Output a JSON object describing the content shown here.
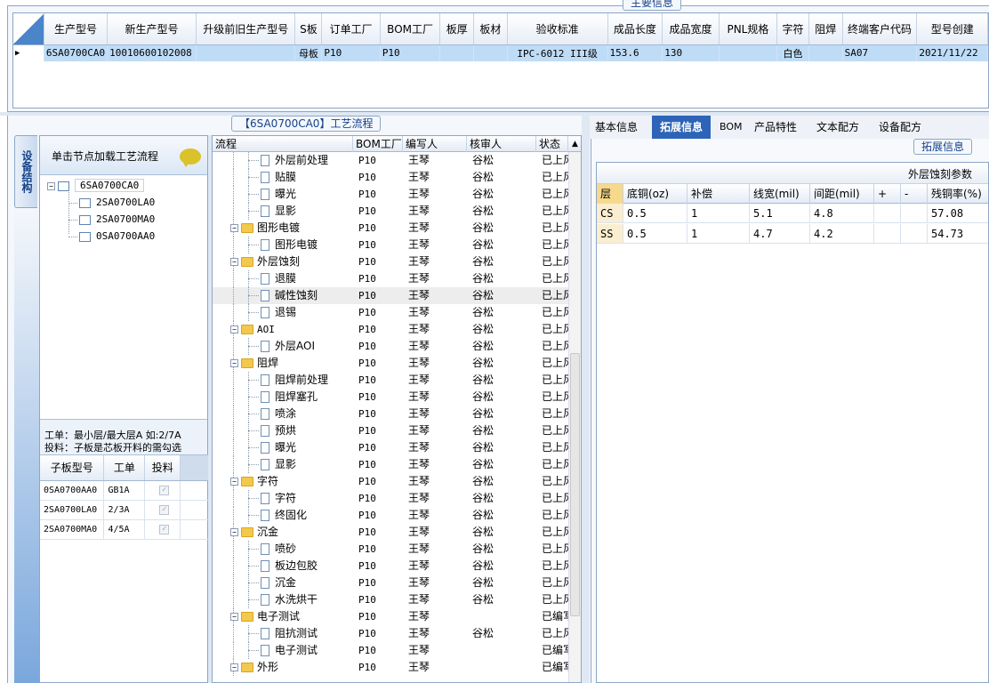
{
  "top": {
    "group_title": "主要信息",
    "columns": [
      "生产型号",
      "新生产型号",
      "升级前旧生产型号",
      "S板",
      "订单工厂",
      "BOM工厂",
      "板厚",
      "板材",
      "验收标准",
      "成品长度",
      "成品宽度",
      "PNL规格",
      "字符",
      "阻焊",
      "终端客户代码",
      "型号创建"
    ],
    "row": [
      "6SA0700CA0",
      "10010600102008",
      "",
      "母板",
      "P10",
      "P10",
      "",
      "",
      "IPC-6012 III级",
      "153.6",
      "130",
      "",
      "白色",
      "",
      "SA07",
      "2021/11/22"
    ]
  },
  "left": {
    "vertical_tab": "设备结构",
    "header_text": "单击节点加载工艺流程",
    "tree": {
      "root": "6SA0700CA0",
      "children": [
        "2SA0700LA0",
        "2SA0700MA0",
        "0SA0700AA0"
      ]
    },
    "note_line1": "工单：最小层/最大层A 如:2/7A",
    "note_line2": "投料：子板是芯板开料的需勾选",
    "subgrid": {
      "columns": [
        "子板型号",
        "工单",
        "投料"
      ],
      "rows": [
        [
          "0SA0700AA0",
          "GB1A",
          "✓"
        ],
        [
          "2SA0700LA0",
          "2/3A",
          "✓"
        ],
        [
          "2SA0700MA0",
          "4/5A",
          "✓"
        ]
      ]
    }
  },
  "middle": {
    "group_title": "【6SA0700CA0】工艺流程",
    "columns": [
      "流程",
      "BOM工厂",
      "编写人",
      "核审人",
      "状态"
    ],
    "rows": [
      {
        "name": "外层前处理",
        "folder": false,
        "bom": "P10",
        "writer": "王琴",
        "reviewer": "谷松",
        "status": "已上风"
      },
      {
        "name": "贴膜",
        "folder": false,
        "bom": "P10",
        "writer": "王琴",
        "reviewer": "谷松",
        "status": "已上风"
      },
      {
        "name": "曝光",
        "folder": false,
        "bom": "P10",
        "writer": "王琴",
        "reviewer": "谷松",
        "status": "已上风"
      },
      {
        "name": "显影",
        "folder": false,
        "bom": "P10",
        "writer": "王琴",
        "reviewer": "谷松",
        "status": "已上风"
      },
      {
        "name": "图形电镀",
        "folder": true,
        "bom": "P10",
        "writer": "王琴",
        "reviewer": "谷松",
        "status": "已上风"
      },
      {
        "name": "图形电镀",
        "folder": false,
        "bom": "P10",
        "writer": "王琴",
        "reviewer": "谷松",
        "status": "已上风"
      },
      {
        "name": "外层蚀刻",
        "folder": true,
        "bom": "P10",
        "writer": "王琴",
        "reviewer": "谷松",
        "status": "已上风"
      },
      {
        "name": "退膜",
        "folder": false,
        "bom": "P10",
        "writer": "王琴",
        "reviewer": "谷松",
        "status": "已上风"
      },
      {
        "name": "碱性蚀刻",
        "folder": false,
        "bom": "P10",
        "writer": "王琴",
        "reviewer": "谷松",
        "status": "已上风",
        "selected": true
      },
      {
        "name": "退锡",
        "folder": false,
        "bom": "P10",
        "writer": "王琴",
        "reviewer": "谷松",
        "status": "已上风"
      },
      {
        "name": "AOI",
        "folder": true,
        "bom": "P10",
        "writer": "王琴",
        "reviewer": "谷松",
        "status": "已上风"
      },
      {
        "name": "外层AOI",
        "folder": false,
        "bom": "P10",
        "writer": "王琴",
        "reviewer": "谷松",
        "status": "已上风"
      },
      {
        "name": "阻焊",
        "folder": true,
        "bom": "P10",
        "writer": "王琴",
        "reviewer": "谷松",
        "status": "已上风"
      },
      {
        "name": "阻焊前处理",
        "folder": false,
        "bom": "P10",
        "writer": "王琴",
        "reviewer": "谷松",
        "status": "已上风"
      },
      {
        "name": "阻焊塞孔",
        "folder": false,
        "bom": "P10",
        "writer": "王琴",
        "reviewer": "谷松",
        "status": "已上风"
      },
      {
        "name": "喷涂",
        "folder": false,
        "bom": "P10",
        "writer": "王琴",
        "reviewer": "谷松",
        "status": "已上风"
      },
      {
        "name": "预烘",
        "folder": false,
        "bom": "P10",
        "writer": "王琴",
        "reviewer": "谷松",
        "status": "已上风"
      },
      {
        "name": "曝光",
        "folder": false,
        "bom": "P10",
        "writer": "王琴",
        "reviewer": "谷松",
        "status": "已上风"
      },
      {
        "name": "显影",
        "folder": false,
        "bom": "P10",
        "writer": "王琴",
        "reviewer": "谷松",
        "status": "已上风"
      },
      {
        "name": "字符",
        "folder": true,
        "bom": "P10",
        "writer": "王琴",
        "reviewer": "谷松",
        "status": "已上风"
      },
      {
        "name": "字符",
        "folder": false,
        "bom": "P10",
        "writer": "王琴",
        "reviewer": "谷松",
        "status": "已上风"
      },
      {
        "name": "终固化",
        "folder": false,
        "bom": "P10",
        "writer": "王琴",
        "reviewer": "谷松",
        "status": "已上风"
      },
      {
        "name": "沉金",
        "folder": true,
        "bom": "P10",
        "writer": "王琴",
        "reviewer": "谷松",
        "status": "已上风"
      },
      {
        "name": "喷砂",
        "folder": false,
        "bom": "P10",
        "writer": "王琴",
        "reviewer": "谷松",
        "status": "已上风"
      },
      {
        "name": "板边包胶",
        "folder": false,
        "bom": "P10",
        "writer": "王琴",
        "reviewer": "谷松",
        "status": "已上风"
      },
      {
        "name": "沉金",
        "folder": false,
        "bom": "P10",
        "writer": "王琴",
        "reviewer": "谷松",
        "status": "已上风"
      },
      {
        "name": "水洗烘干",
        "folder": false,
        "bom": "P10",
        "writer": "王琴",
        "reviewer": "谷松",
        "status": "已上风"
      },
      {
        "name": "电子测试",
        "folder": true,
        "bom": "P10",
        "writer": "王琴",
        "reviewer": "",
        "status": "已编写"
      },
      {
        "name": "阻抗测试",
        "folder": false,
        "bom": "P10",
        "writer": "王琴",
        "reviewer": "谷松",
        "status": "已上风"
      },
      {
        "name": "电子测试",
        "folder": false,
        "bom": "P10",
        "writer": "王琴",
        "reviewer": "",
        "status": "已编写"
      },
      {
        "name": "外形",
        "folder": true,
        "bom": "P10",
        "writer": "王琴",
        "reviewer": "",
        "status": "已编写"
      }
    ]
  },
  "right": {
    "tabs": [
      "基本信息",
      "拓展信息",
      "BOM",
      "产品特性",
      "文本配方",
      "设备配方"
    ],
    "active_tab": "拓展信息",
    "group_title": "拓展信息",
    "param_title": "外层蚀刻参数",
    "columns": [
      "层",
      "底铜(oz)",
      "补偿",
      "线宽(mil)",
      "间距(mil)",
      "+",
      "-",
      "残铜率(%)"
    ],
    "rows": [
      [
        "CS",
        "0.5",
        "1",
        "5.1",
        "4.8",
        "",
        "",
        "57.08"
      ],
      [
        "SS",
        "0.5",
        "1",
        "4.7",
        "4.2",
        "",
        "",
        "54.73"
      ]
    ]
  }
}
